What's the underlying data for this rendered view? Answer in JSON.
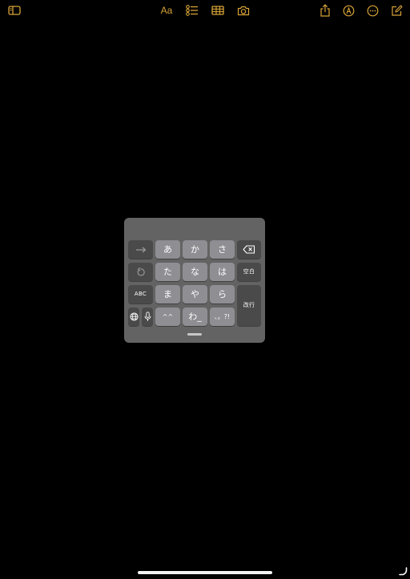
{
  "toolbar": {
    "left": [
      {
        "icon": "sidebar-icon"
      }
    ],
    "center": [
      {
        "icon": "format-icon",
        "label": "Aa"
      },
      {
        "icon": "checklist-icon"
      },
      {
        "icon": "table-icon"
      },
      {
        "icon": "camera-icon"
      }
    ],
    "right": [
      {
        "icon": "share-icon"
      },
      {
        "icon": "markup-icon"
      },
      {
        "icon": "more-icon"
      },
      {
        "icon": "compose-icon"
      }
    ],
    "accent_color": "#d8a437"
  },
  "keyboard": {
    "background": "#636363",
    "key_color": "#8e8e93",
    "rows": {
      "r1": {
        "a": "あ",
        "ka": "か",
        "sa": "さ"
      },
      "r2": {
        "ta": "た",
        "na": "な",
        "ha": "は"
      },
      "r3": {
        "ma": "ま",
        "ya": "や",
        "ra": "ら"
      },
      "r4": {
        "face": "^^",
        "wa": "わ_",
        "punct": "、。?!"
      }
    },
    "abc_label": "ABC",
    "space_label": "空白",
    "enter_label": "改行"
  }
}
